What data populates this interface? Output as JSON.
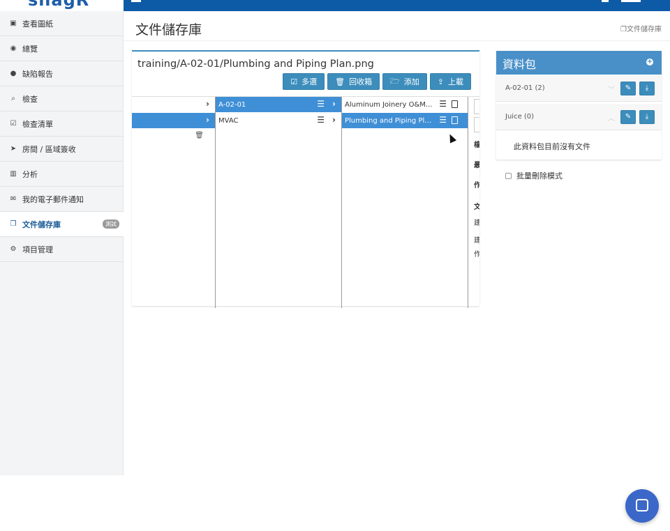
{
  "app": {
    "logo": "snagR"
  },
  "sidebar": {
    "items": [
      {
        "icon": "image-icon",
        "glyph": "▣",
        "label": "查看圖紙"
      },
      {
        "icon": "dashboard-icon",
        "glyph": "◉",
        "label": "總覽"
      },
      {
        "icon": "map-marker-icon",
        "glyph": "●",
        "label": "缺陷報告"
      },
      {
        "icon": "search-icon",
        "glyph": "⌕",
        "label": "檢查"
      },
      {
        "icon": "checkbox-icon",
        "glyph": "☑",
        "label": "檢查清單"
      },
      {
        "icon": "location-arrow-icon",
        "glyph": "➤",
        "label": "房間 / 區域簽收"
      },
      {
        "icon": "bar-chart-icon",
        "glyph": "▥",
        "label": "分析"
      },
      {
        "icon": "envelope-icon",
        "glyph": "✉",
        "label": "我的電子郵件通知"
      },
      {
        "icon": "copy-icon",
        "glyph": "❐",
        "label": "文件儲存庫",
        "badge": "測試"
      },
      {
        "icon": "cogs-icon",
        "glyph": "⚙",
        "label": "項目管理"
      }
    ]
  },
  "header": {
    "title": "文件儲存庫",
    "breadcrumb": "文件儲存庫",
    "breadcrumb_icon": "copy-icon"
  },
  "browser": {
    "path": "training/A-02-01/Plumbing and Piping Plan.png",
    "toolbar": [
      {
        "icon": "check-square-icon",
        "glyph": "☑",
        "label": "多選"
      },
      {
        "icon": "trash-icon",
        "glyph": "🗑",
        "label": "回收箱"
      },
      {
        "icon": "folder-open-icon",
        "glyph": "🗁",
        "label": "添加"
      },
      {
        "icon": "upload-icon",
        "glyph": "⇪",
        "label": "上載"
      }
    ],
    "col2": [
      {
        "label": "A-02-01",
        "selected": true
      },
      {
        "label": "MVAC",
        "selected": false
      }
    ],
    "col3": [
      {
        "label": "Aluminum Joinery O&M...",
        "selected": false,
        "file_icon": "file-pdf-icon"
      },
      {
        "label": "Plumbing and Piping Pla...",
        "selected": true,
        "file_icon": "file-image-icon"
      }
    ],
    "col4_chars": [
      "檔",
      "最",
      "作",
      "文",
      "建",
      "建",
      "作"
    ]
  },
  "packages": {
    "title": "資料包",
    "items": [
      {
        "name": "A-02-01 (2)",
        "caret": "﹀"
      },
      {
        "name": "Juice (0)",
        "caret": "︿"
      }
    ],
    "empty_text": "此資料包目前沒有文件",
    "bulk_delete_label": "批量刪除模式"
  }
}
